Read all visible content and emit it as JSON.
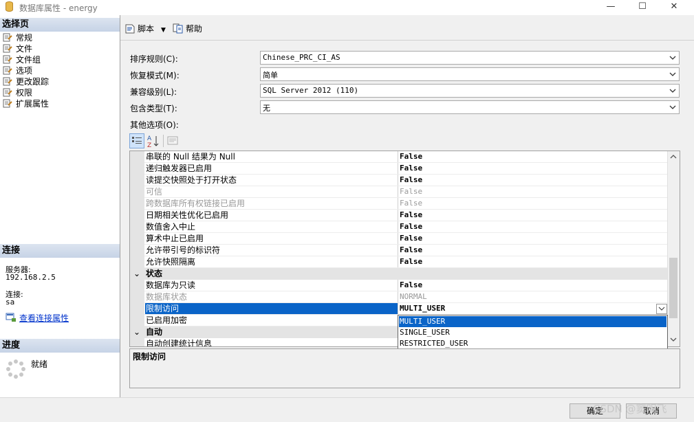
{
  "window": {
    "title": "数据库属性 - energy",
    "minimize": "—",
    "maximize": "☐",
    "close": "✕"
  },
  "left": {
    "select_page_header": "选择页",
    "pages": [
      {
        "label": "常规"
      },
      {
        "label": "文件"
      },
      {
        "label": "文件组"
      },
      {
        "label": "选项"
      },
      {
        "label": "更改跟踪"
      },
      {
        "label": "权限"
      },
      {
        "label": "扩展属性"
      }
    ],
    "connection_header": "连接",
    "server_label": "服务器:",
    "server_value": "192.168.2.5",
    "conn_label": "连接:",
    "conn_value": "sa",
    "view_conn_props": "查看连接属性",
    "progress_header": "进度",
    "progress_status": "就绪"
  },
  "toolbar": {
    "script_label": "脚本",
    "help_label": "帮助"
  },
  "form": {
    "collation_label": "排序规则(C):",
    "collation_value": "Chinese_PRC_CI_AS",
    "recovery_label": "恢复模式(M):",
    "recovery_value": "简单",
    "compat_label": "兼容级别(L):",
    "compat_value": "SQL Server 2012 (110)",
    "containment_label": "包含类型(T):",
    "containment_value": "无",
    "other_options_label": "其他选项(O):"
  },
  "grid": {
    "rows": [
      {
        "name": "串联的 Null 结果为 Null",
        "value": "False",
        "disabled": false
      },
      {
        "name": "递归触发器已启用",
        "value": "False",
        "disabled": false
      },
      {
        "name": "读提交快照处于打开状态",
        "value": "False",
        "disabled": false
      },
      {
        "name": "可信",
        "value": "False",
        "disabled": true
      },
      {
        "name": "跨数据库所有权链接已启用",
        "value": "False",
        "disabled": true
      },
      {
        "name": "日期相关性优化已启用",
        "value": "False",
        "disabled": false
      },
      {
        "name": "数值舍入中止",
        "value": "False",
        "disabled": false
      },
      {
        "name": "算术中止已启用",
        "value": "False",
        "disabled": false
      },
      {
        "name": "允许带引号的标识符",
        "value": "False",
        "disabled": false
      },
      {
        "name": "允许快照隔离",
        "value": "False",
        "disabled": false
      }
    ],
    "category_status": "状态",
    "status_rows": [
      {
        "name": "数据库为只读",
        "value": "False",
        "disabled": false
      },
      {
        "name": "数据库状态",
        "value": "NORMAL",
        "disabled": true
      },
      {
        "name": "限制访问",
        "value": "MULTI_USER",
        "selected": true
      },
      {
        "name": "已启用加密",
        "value": ""
      }
    ],
    "category_auto": "自动",
    "auto_partial": "自动创建统计信息",
    "collapse_glyph": "⌄"
  },
  "dropdown": {
    "options": [
      "MULTI_USER",
      "SINGLE_USER",
      "RESTRICTED_USER"
    ],
    "selected": "MULTI_USER"
  },
  "description": {
    "title": "限制访问"
  },
  "buttons": {
    "ok": "确定",
    "cancel": "取消"
  },
  "watermark": "CSDN @窦明飞",
  "colors": {
    "selection": "#0a64c8",
    "header_gradient_top": "#dce4f0",
    "header_gradient_bottom": "#c6d3e6"
  }
}
